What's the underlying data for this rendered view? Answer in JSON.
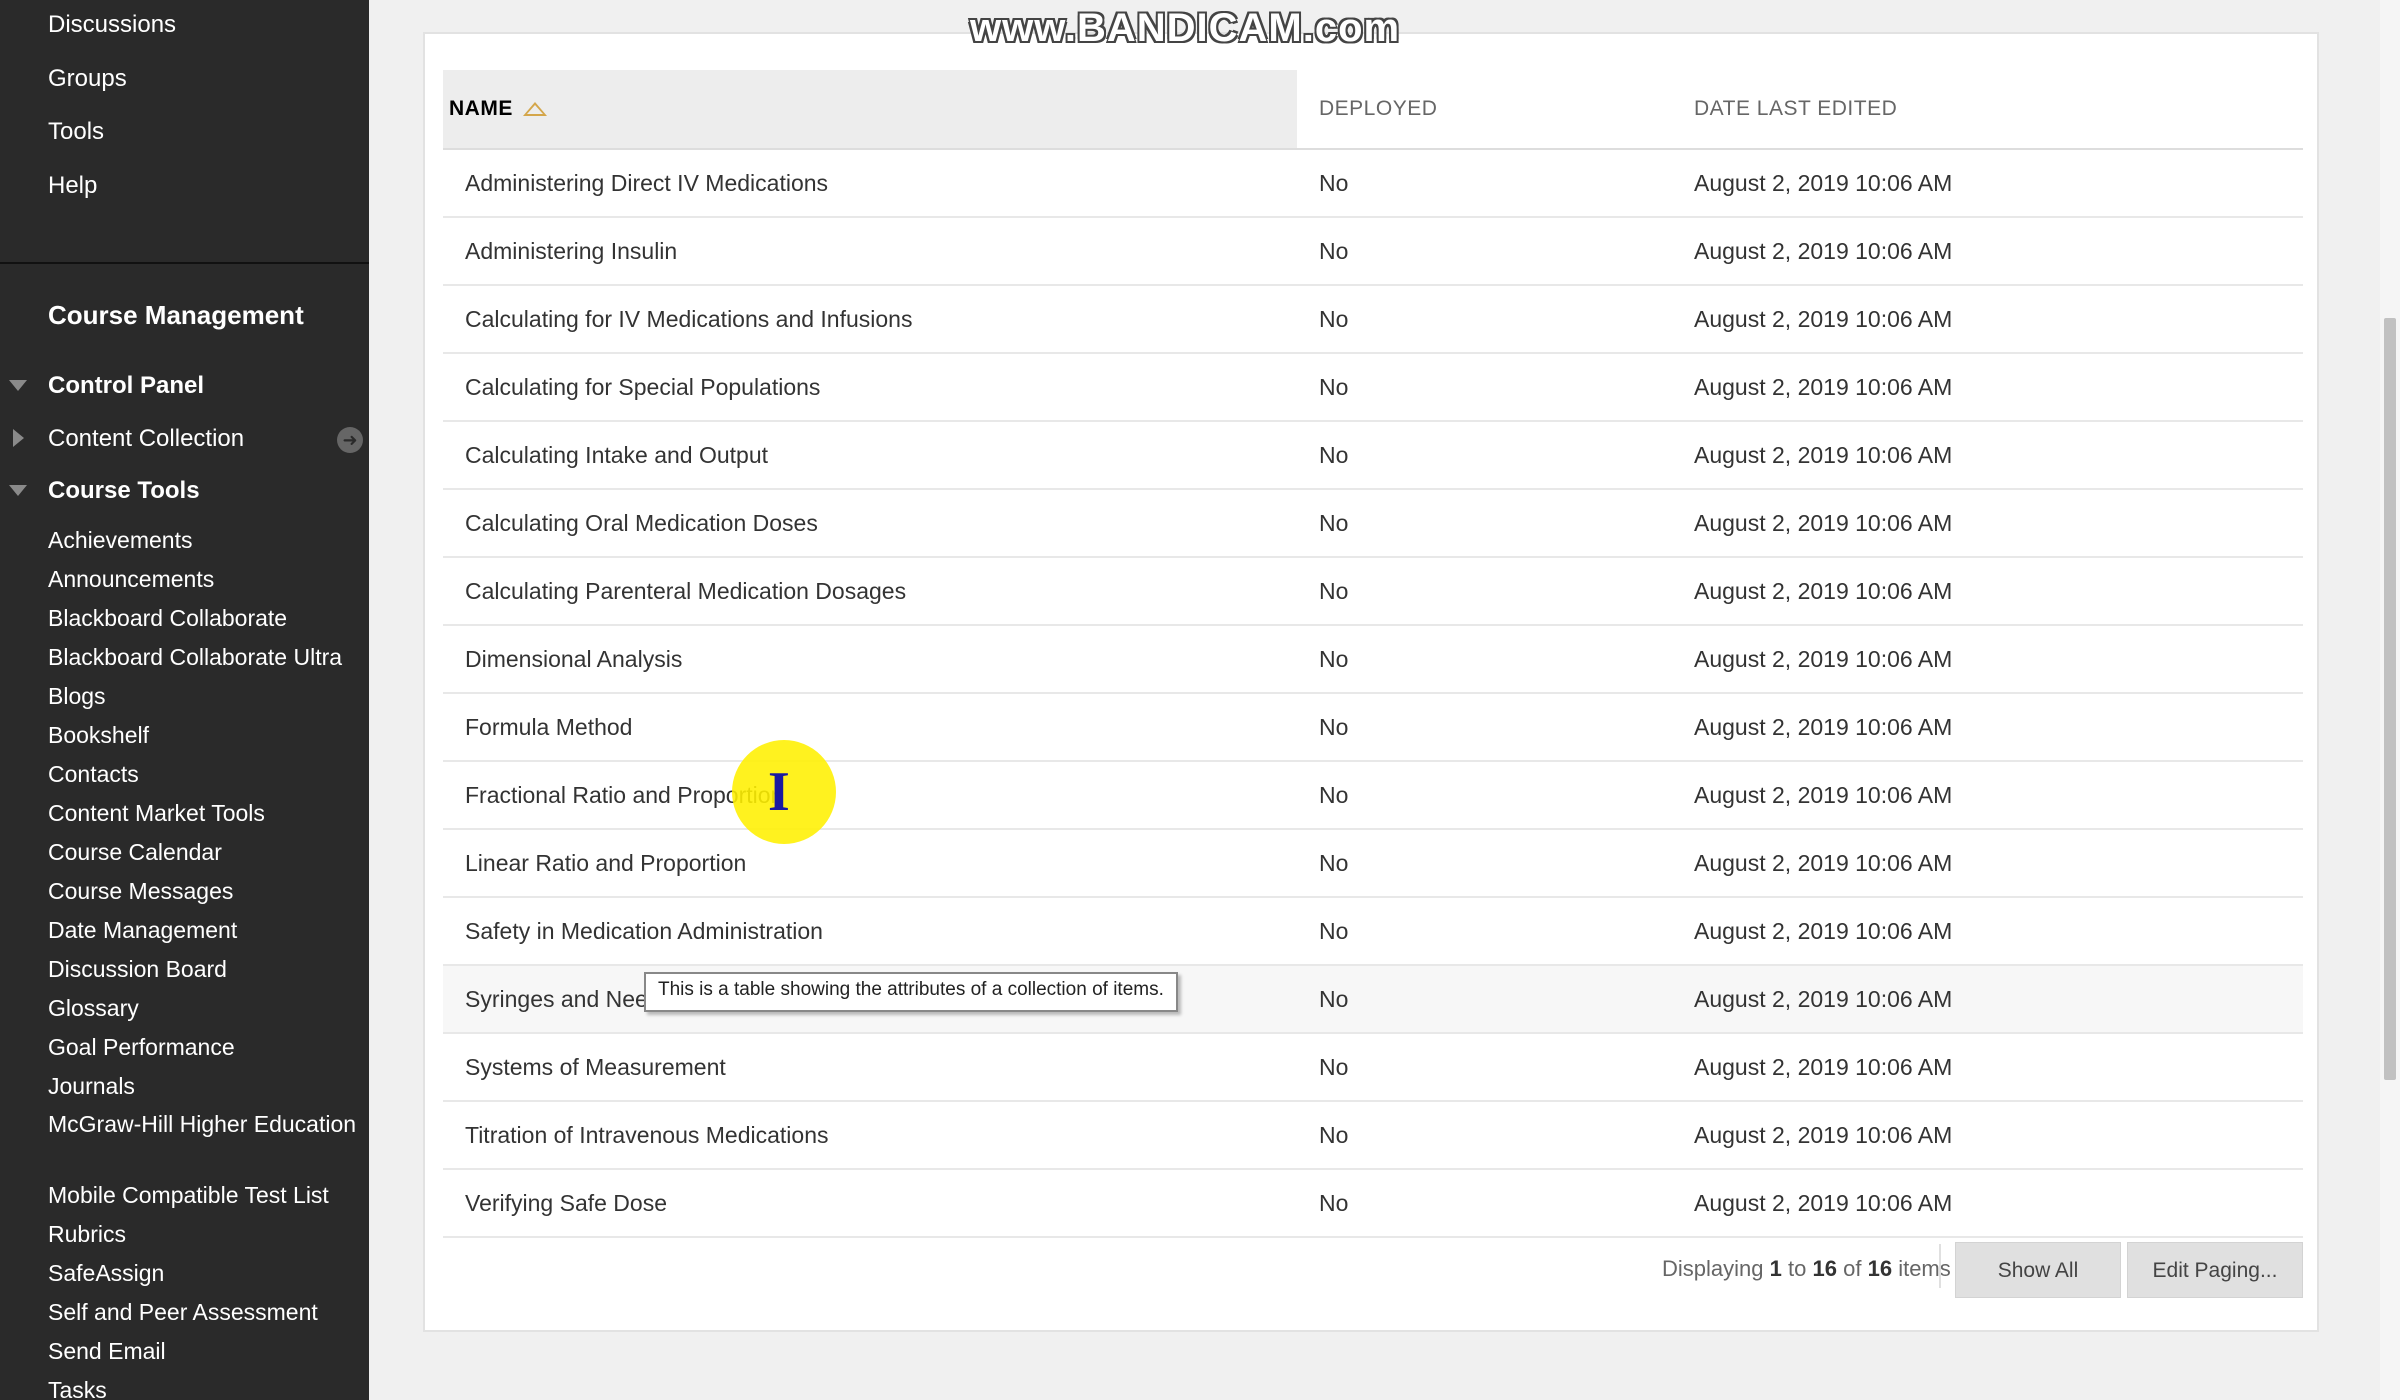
{
  "watermark": "www.BANDICAM.com",
  "sidebar": {
    "top_items": [
      "Discussions",
      "Groups",
      "Tools",
      "Help"
    ],
    "course_management": "Course Management",
    "control_panel": "Control Panel",
    "content_collection": "Content Collection",
    "course_tools": "Course Tools",
    "tools": [
      "Achievements",
      "Announcements",
      "Blackboard Collaborate",
      "Blackboard Collaborate Ultra",
      "Blogs",
      "Bookshelf",
      "Contacts",
      "Content Market Tools",
      "Course Calendar",
      "Course Messages",
      "Date Management",
      "Discussion Board",
      "Glossary",
      "Goal Performance",
      "Journals",
      "McGraw-Hill Higher Education",
      "Mobile Compatible Test List",
      "Rubrics",
      "SafeAssign",
      "Self and Peer Assessment",
      "Send Email",
      "Tasks"
    ]
  },
  "table": {
    "headers": {
      "name": "NAME",
      "deployed": "DEPLOYED",
      "date": "DATE LAST EDITED"
    },
    "rows": [
      {
        "name": "Administering Direct IV Medications",
        "deployed": "No",
        "date": "August 2, 2019 10:06 AM"
      },
      {
        "name": "Administering Insulin",
        "deployed": "No",
        "date": "August 2, 2019 10:06 AM"
      },
      {
        "name": "Calculating for IV Medications and Infusions",
        "deployed": "No",
        "date": "August 2, 2019 10:06 AM"
      },
      {
        "name": "Calculating for Special Populations",
        "deployed": "No",
        "date": "August 2, 2019 10:06 AM"
      },
      {
        "name": "Calculating Intake and Output",
        "deployed": "No",
        "date": "August 2, 2019 10:06 AM"
      },
      {
        "name": "Calculating Oral Medication Doses",
        "deployed": "No",
        "date": "August 2, 2019 10:06 AM"
      },
      {
        "name": "Calculating Parenteral Medication Dosages",
        "deployed": "No",
        "date": "August 2, 2019 10:06 AM"
      },
      {
        "name": "Dimensional Analysis",
        "deployed": "No",
        "date": "August 2, 2019 10:06 AM"
      },
      {
        "name": "Formula Method",
        "deployed": "No",
        "date": "August 2, 2019 10:06 AM"
      },
      {
        "name": "Fractional Ratio and Proportion",
        "deployed": "No",
        "date": "August 2, 2019 10:06 AM"
      },
      {
        "name": "Linear Ratio and Proportion",
        "deployed": "No",
        "date": "August 2, 2019 10:06 AM"
      },
      {
        "name": "Safety in Medication Administration",
        "deployed": "No",
        "date": "August 2, 2019 10:06 AM"
      },
      {
        "name": "Syringes and Needles",
        "deployed": "No",
        "date": "August 2, 2019 10:06 AM"
      },
      {
        "name": "Systems of Measurement",
        "deployed": "No",
        "date": "August 2, 2019 10:06 AM"
      },
      {
        "name": "Titration of Intravenous Medications",
        "deployed": "No",
        "date": "August 2, 2019 10:06 AM"
      },
      {
        "name": "Verifying Safe Dose",
        "deployed": "No",
        "date": "August 2, 2019 10:06 AM"
      }
    ]
  },
  "pager": {
    "prefix": "Displaying",
    "from": "1",
    "to_word": "to",
    "to": "16",
    "of_word": "of",
    "total": "16",
    "suffix": "items",
    "show_all": "Show All",
    "edit_paging": "Edit Paging..."
  },
  "tooltip": "This is a table showing the attributes of a collection of items.",
  "icons": {
    "expanded": "triangle-down-icon",
    "collapsed": "triangle-right-icon",
    "goto": "circle-arrow-icon",
    "sort": "sort-ascending-icon",
    "cursor": "text-cursor-icon"
  }
}
